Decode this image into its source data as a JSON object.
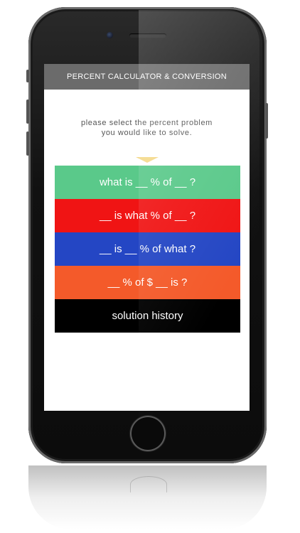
{
  "app": {
    "title": "PERCENT CALCULATOR & CONVERSION"
  },
  "prompt": {
    "line1": "please select the percent problem",
    "line2": "you would like to solve."
  },
  "menu": {
    "items": [
      {
        "label": "what is __ % of __ ?",
        "color": "#5ac98a"
      },
      {
        "label": "__ is what % of __ ?",
        "color": "#f01414"
      },
      {
        "label": "__ is __ % of what ?",
        "color": "#2446c4"
      },
      {
        "label": "__ % of $ __ is ?",
        "color": "#f45a2a"
      },
      {
        "label": "solution history",
        "color": "#000000"
      }
    ]
  },
  "icons": {
    "pointer": "triangle-down-icon",
    "camera": "camera-icon",
    "home": "home-button-icon"
  }
}
